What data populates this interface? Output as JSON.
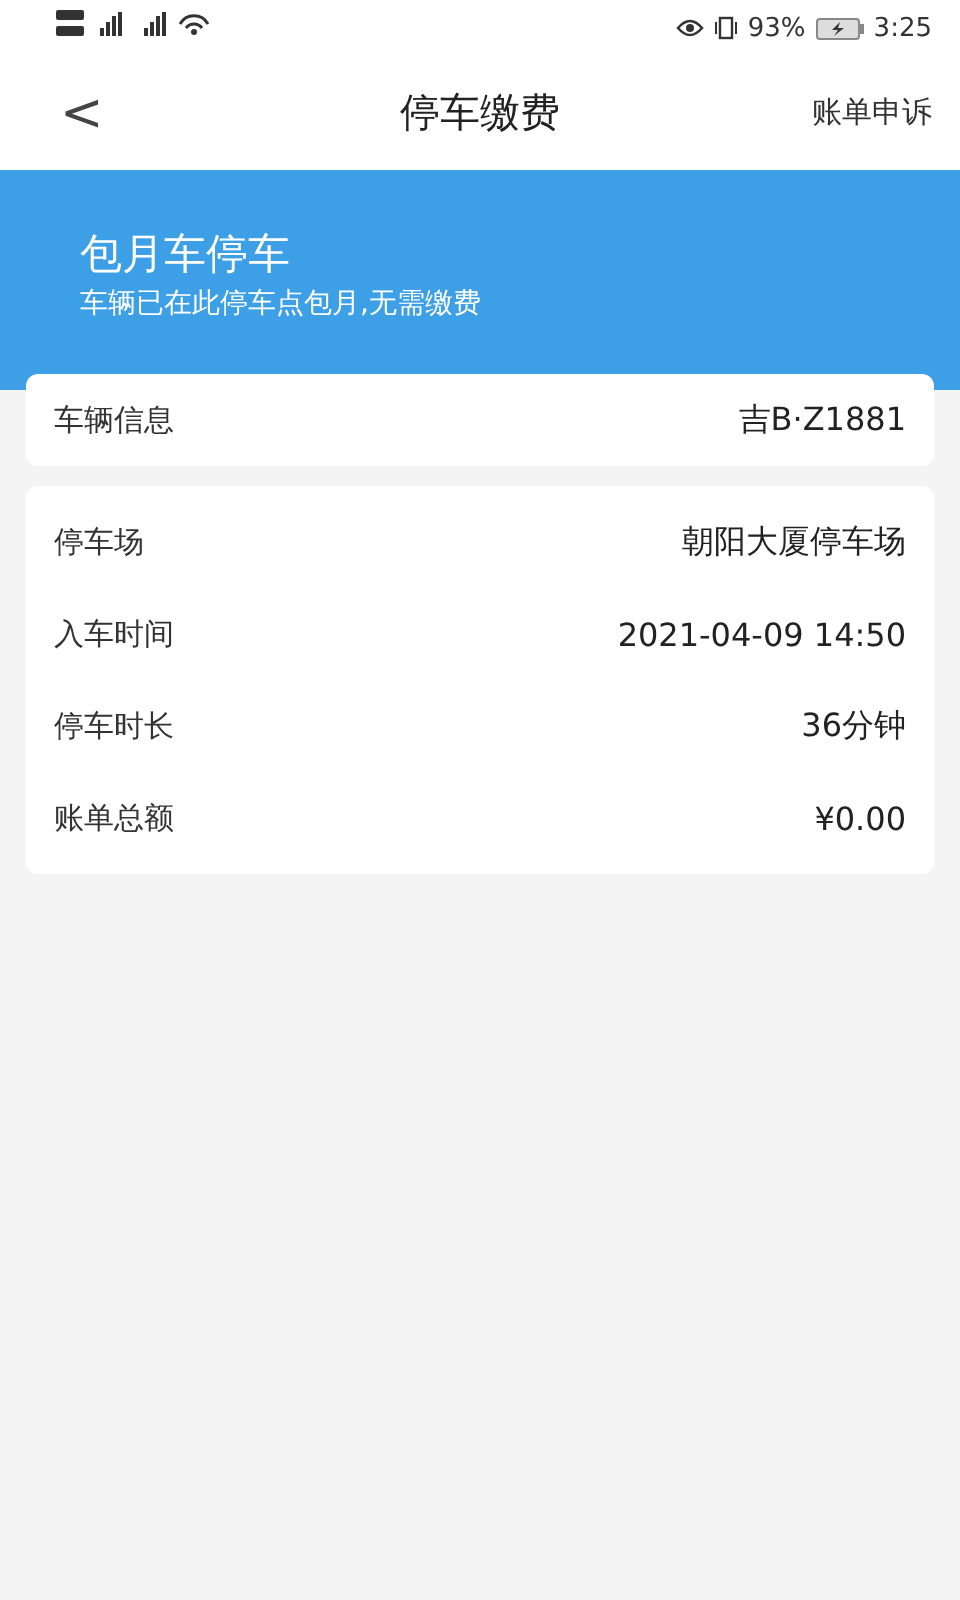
{
  "status_bar": {
    "battery": "93%",
    "time": "3:25"
  },
  "header": {
    "back": "<",
    "title": "停车缴费",
    "action": "账单申诉"
  },
  "banner": {
    "title": "包月车停车",
    "subtitle": "车辆已在此停车点包月,无需缴费"
  },
  "vehicle": {
    "label": "车辆信息",
    "value": "吉B·Z1881"
  },
  "details": [
    {
      "label": "停车场",
      "value": "朝阳大厦停车场"
    },
    {
      "label": "入车时间",
      "value": "2021-04-09 14:50"
    },
    {
      "label": "停车时长",
      "value": "36分钟"
    },
    {
      "label": "账单总额",
      "value": "¥0.00"
    }
  ]
}
